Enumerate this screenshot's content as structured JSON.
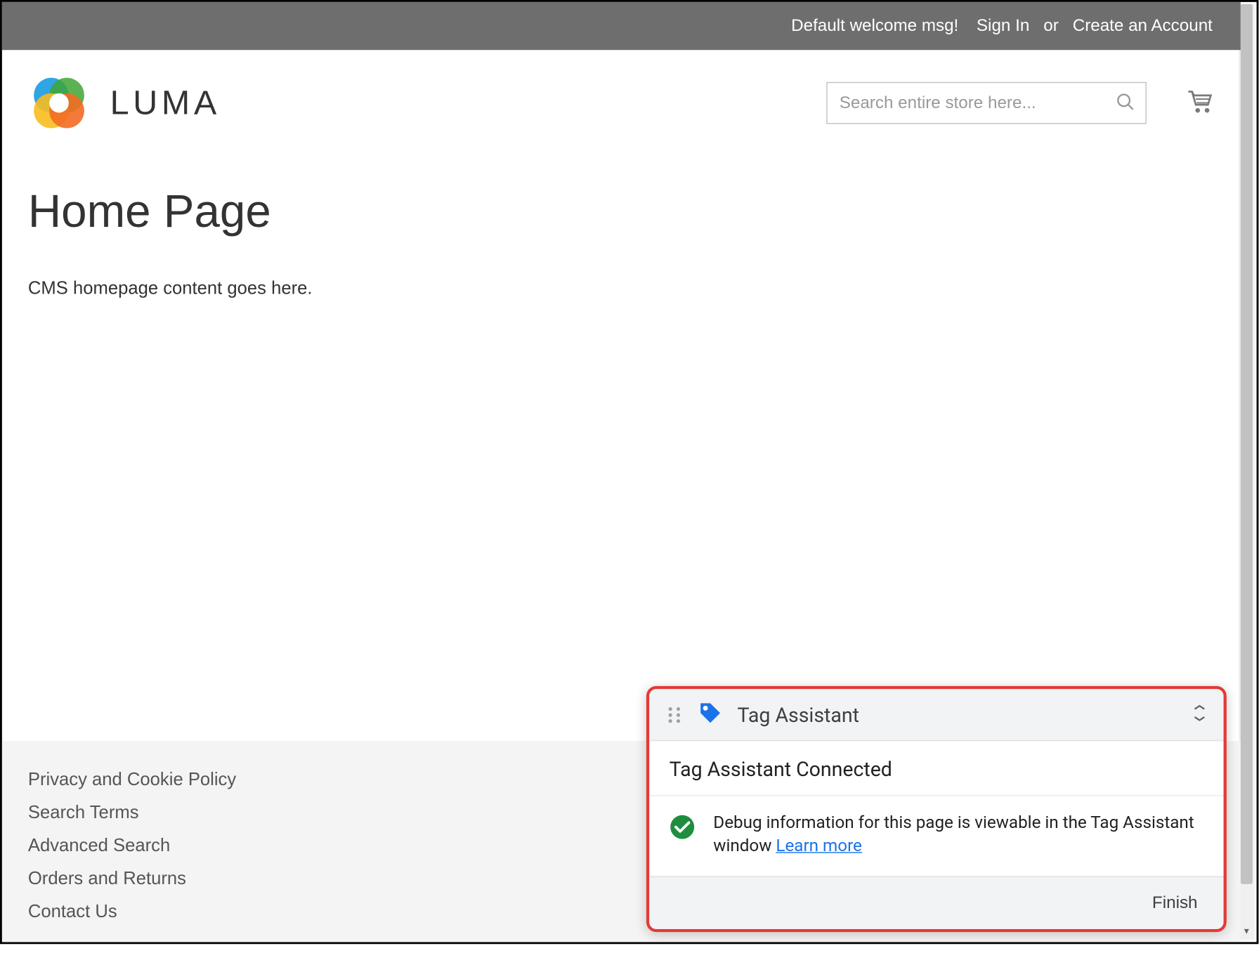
{
  "topbar": {
    "welcome": "Default welcome msg!",
    "sign_in": "Sign In",
    "or": "or",
    "create_account": "Create an Account"
  },
  "header": {
    "brand": "LUMA",
    "search_placeholder": "Search entire store here..."
  },
  "main": {
    "title": "Home Page",
    "cms_text": "CMS homepage content goes here."
  },
  "footer": {
    "links": [
      "Privacy and Cookie Policy",
      "Search Terms",
      "Advanced Search",
      "Orders and Returns",
      "Contact Us"
    ]
  },
  "tag_assistant": {
    "title": "Tag Assistant",
    "status": "Tag Assistant Connected",
    "message": "Debug information for this page is viewable in the Tag Assistant window ",
    "learn_more": "Learn more",
    "finish": "Finish"
  }
}
